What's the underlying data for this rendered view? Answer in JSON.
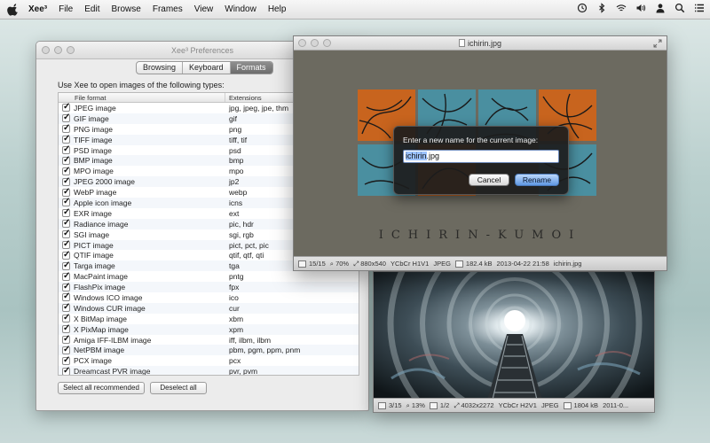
{
  "menubar": {
    "app_name": "Xee³",
    "items": [
      "File",
      "Edit",
      "Browse",
      "Frames",
      "View",
      "Window",
      "Help"
    ],
    "status_icons": [
      "time-machine-icon",
      "bluetooth-icon",
      "wifi-icon",
      "volume-icon",
      "user-icon",
      "spotlight-icon",
      "notification-list-icon"
    ]
  },
  "prefs": {
    "title": "Xee³ Preferences",
    "tabs": [
      "Browsing",
      "Keyboard",
      "Formats"
    ],
    "active_tab": "Formats",
    "intro": "Use Xee to open images of the following types:",
    "columns": [
      "File format",
      "Extensions"
    ],
    "rows": [
      {
        "format": "JPEG image",
        "ext": "jpg, jpeg, jpe, thm",
        "checked": true
      },
      {
        "format": "GIF image",
        "ext": "gif",
        "checked": true
      },
      {
        "format": "PNG image",
        "ext": "png",
        "checked": true
      },
      {
        "format": "TIFF image",
        "ext": "tiff, tif",
        "checked": true
      },
      {
        "format": "PSD image",
        "ext": "psd",
        "checked": true
      },
      {
        "format": "BMP image",
        "ext": "bmp",
        "checked": true
      },
      {
        "format": "MPO image",
        "ext": "mpo",
        "checked": true
      },
      {
        "format": "JPEG 2000 image",
        "ext": "jp2",
        "checked": true
      },
      {
        "format": "WebP image",
        "ext": "webp",
        "checked": true
      },
      {
        "format": "Apple icon image",
        "ext": "icns",
        "checked": true
      },
      {
        "format": "EXR image",
        "ext": "ext",
        "checked": true
      },
      {
        "format": "Radiance image",
        "ext": "pic, hdr",
        "checked": true
      },
      {
        "format": "SGI image",
        "ext": "sgi, rgb",
        "checked": true
      },
      {
        "format": "PICT image",
        "ext": "pict, pct, pic",
        "checked": true
      },
      {
        "format": "QTIF image",
        "ext": "qtif, qtf, qti",
        "checked": true
      },
      {
        "format": "Targa image",
        "ext": "tga",
        "checked": true
      },
      {
        "format": "MacPaint image",
        "ext": "pntg",
        "checked": true
      },
      {
        "format": "FlashPix image",
        "ext": "fpx",
        "checked": true
      },
      {
        "format": "Windows ICO image",
        "ext": "ico",
        "checked": true
      },
      {
        "format": "Windows CUR image",
        "ext": "cur",
        "checked": true
      },
      {
        "format": "X BitMap image",
        "ext": "xbm",
        "checked": true
      },
      {
        "format": "X PixMap image",
        "ext": "xpm",
        "checked": true
      },
      {
        "format": "Amiga IFF-ILBM image",
        "ext": "iff, ilbm, ilbm",
        "checked": true
      },
      {
        "format": "NetPBM image",
        "ext": "pbm, pgm, ppm, pnm",
        "checked": true
      },
      {
        "format": "PCX image",
        "ext": "pcx",
        "checked": true
      },
      {
        "format": "Dreamcast PVR image",
        "ext": "pvr, pvm",
        "checked": true
      }
    ],
    "select_all_label": "Select all recommended",
    "deselect_all_label": "Deselect all"
  },
  "image_window": {
    "title": "ichirin.jpg",
    "caption": "ICHIRIN-KUMOI",
    "status": {
      "index": "15/15",
      "zoom": "70%",
      "dimensions": "880x540",
      "color": "YCbCr H1V1",
      "format": "JPEG",
      "size": "182.4 kB",
      "date": "2013-04-22 21:58",
      "filename": "ichirin.jpg"
    }
  },
  "rename_dialog": {
    "prompt": "Enter a new name for the current image:",
    "name_selected": "ichirin",
    "name_ext": ".jpg",
    "cancel_label": "Cancel",
    "rename_label": "Rename"
  },
  "tunnel_window": {
    "status": {
      "index": "3/15",
      "zoom": "13%",
      "page": "1/2",
      "dimensions": "4032x2272",
      "color": "YCbCr H2V1",
      "format": "JPEG",
      "size": "1804 kB",
      "date": "2011-0..."
    }
  },
  "colors": {
    "tile_orange": "#c8641e",
    "tile_teal": "#4a8fa0",
    "dialog_bg": "#1c1c1c",
    "primary_button": "#5f98e3",
    "selection": "#9cc3ff"
  }
}
